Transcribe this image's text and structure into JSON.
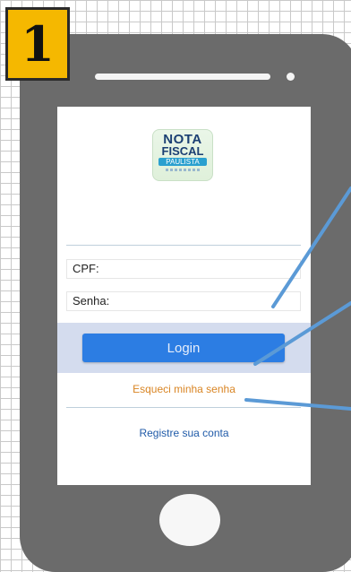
{
  "step_number": "1",
  "app": {
    "logo": {
      "line1": "NOTA",
      "line2": "FISCAL",
      "line3": "PAULISTA"
    },
    "cpf_label": "CPF:",
    "senha_label": "Senha:",
    "login_button": "Login",
    "forgot_password_link": "Esqueci minha senha",
    "register_link": "Registre sua conta"
  },
  "colors": {
    "badge": "#f5b800",
    "phone_body": "#6b6b6b",
    "login_button": "#2c7de3",
    "forgot_link": "#d98524",
    "register_link": "#1f5aa8",
    "pointer_lines": "#5b9ad6"
  }
}
